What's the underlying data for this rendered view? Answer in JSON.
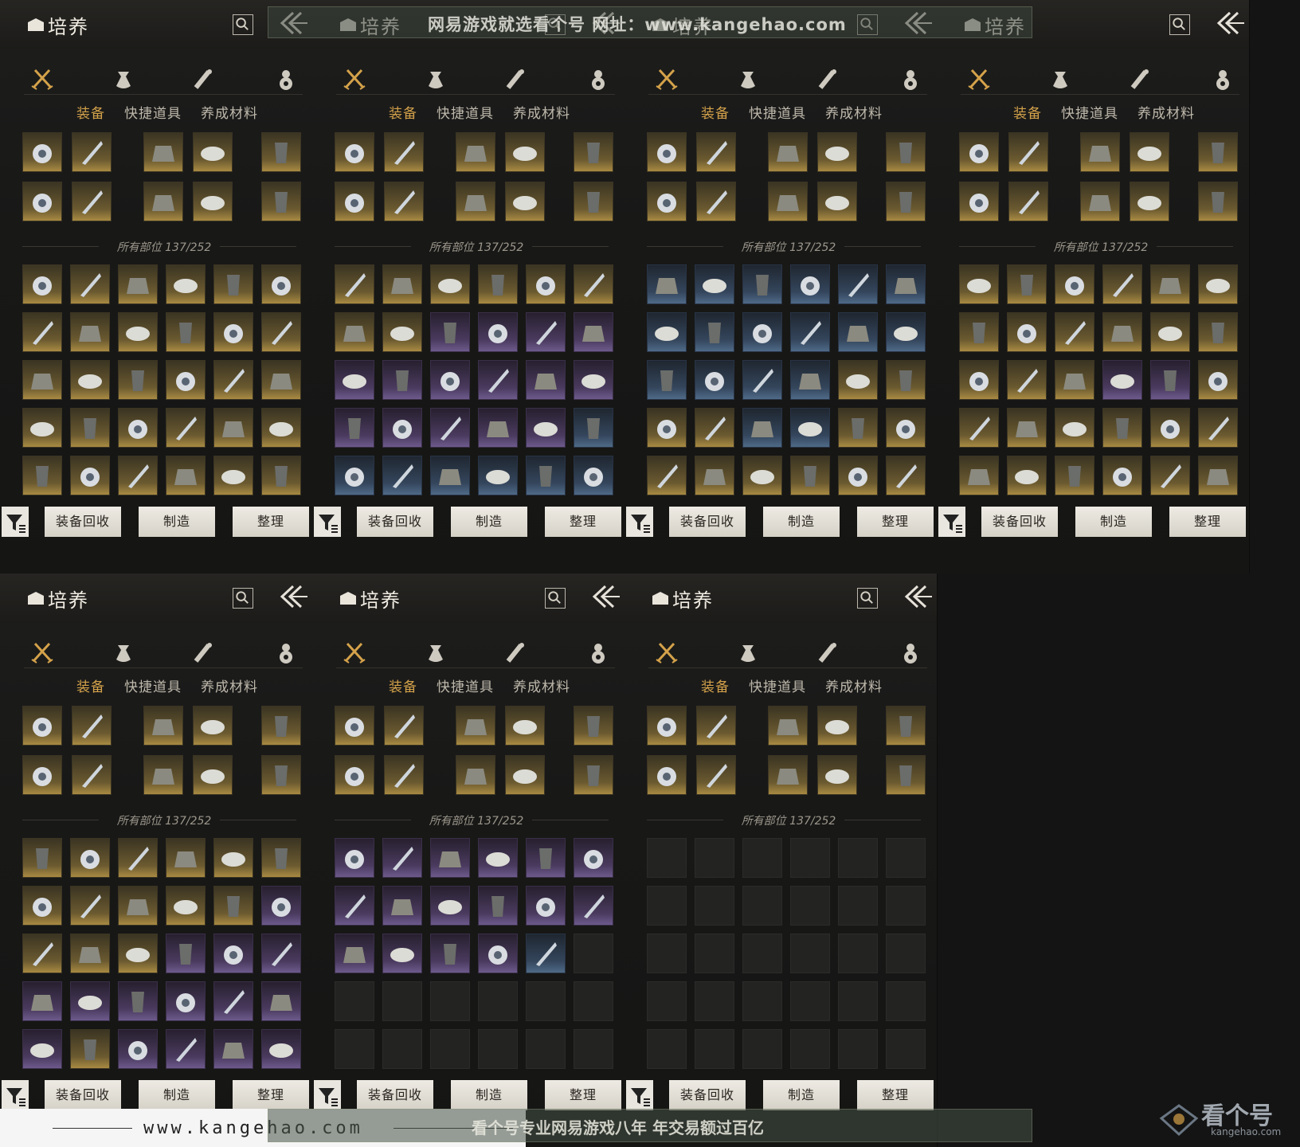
{
  "header": {
    "title": "培养"
  },
  "tabs": {
    "items": [
      "装备",
      "快捷道具",
      "养成材料"
    ]
  },
  "position_count": "所有部位 137/252",
  "buttons": {
    "recycle": "装备回收",
    "craft": "制造",
    "arrange": "整理"
  },
  "icons": {
    "categories": [
      "crossed-swords-icon",
      "pouch-icon",
      "scroll-icon",
      "gourd-icon"
    ],
    "search": "search-icon",
    "back": "back-arrow-icon",
    "filter": "filter-icon"
  },
  "colors": {
    "gold": "#a88a42",
    "blue": "#4f6a88",
    "purple": "#6d5a8c",
    "accent": "#d4a24a"
  },
  "panels": [
    {
      "grid": [
        "g",
        "g",
        "g",
        "g",
        "g",
        "g",
        "g",
        "g",
        "g",
        "g",
        "g",
        "g",
        "g",
        "g",
        "g",
        "g",
        "g",
        "g",
        "g",
        "g",
        "g",
        "g",
        "g",
        "g",
        "g",
        "g",
        "g",
        "g",
        "g",
        "g"
      ]
    },
    {
      "grid": [
        "g",
        "g",
        "g",
        "g",
        "g",
        "g",
        "g",
        "g",
        "p",
        "p",
        "p",
        "p",
        "p",
        "p",
        "p",
        "p",
        "p",
        "p",
        "p",
        "p",
        "p",
        "p",
        "p",
        "b",
        "b",
        "b",
        "b",
        "b",
        "b",
        "b"
      ]
    },
    {
      "grid": [
        "b",
        "b",
        "b",
        "b",
        "b",
        "b",
        "b",
        "b",
        "b",
        "b",
        "b",
        "b",
        "b",
        "b",
        "b",
        "b",
        "g",
        "g",
        "g",
        "g",
        "b",
        "b",
        "g",
        "g",
        "g",
        "g",
        "g",
        "g",
        "g",
        "g"
      ]
    },
    {
      "grid": [
        "g",
        "g",
        "g",
        "g",
        "g",
        "g",
        "g",
        "g",
        "g",
        "g",
        "g",
        "g",
        "g",
        "g",
        "g",
        "p",
        "p",
        "g",
        "g",
        "g",
        "g",
        "g",
        "g",
        "g",
        "g",
        "g",
        "g",
        "g",
        "g",
        "g"
      ]
    },
    {
      "grid": [
        "g",
        "g",
        "g",
        "g",
        "g",
        "g",
        "g",
        "g",
        "g",
        "g",
        "g",
        "p",
        "g",
        "g",
        "g",
        "p",
        "p",
        "p",
        "p",
        "p",
        "p",
        "p",
        "p",
        "p",
        "p",
        "g",
        "p",
        "p",
        "p",
        "p"
      ]
    },
    {
      "grid": [
        "p",
        "p",
        "p",
        "p",
        "p",
        "p",
        "p",
        "p",
        "p",
        "p",
        "p",
        "p",
        "p",
        "p",
        "p",
        "p",
        "b",
        "e",
        "e",
        "e",
        "e",
        "e",
        "e",
        "e",
        "e",
        "e",
        "e",
        "e",
        "e",
        "e"
      ]
    },
    {
      "grid": [
        "e",
        "e",
        "e",
        "e",
        "e",
        "e",
        "e",
        "e",
        "e",
        "e",
        "e",
        "e",
        "e",
        "e",
        "e",
        "e",
        "e",
        "e",
        "e",
        "e",
        "e",
        "e",
        "e",
        "e",
        "e",
        "e",
        "e",
        "e",
        "e",
        "e"
      ]
    }
  ],
  "watermark": {
    "top": "网易游戏就选看个号  网址：www.kangehao.com",
    "url": "www.kangehao.com",
    "slogan": "看个号专业网易游戏八年  年交易额过百亿",
    "logo": "看个号",
    "logo_sub": "kangehao.com"
  }
}
